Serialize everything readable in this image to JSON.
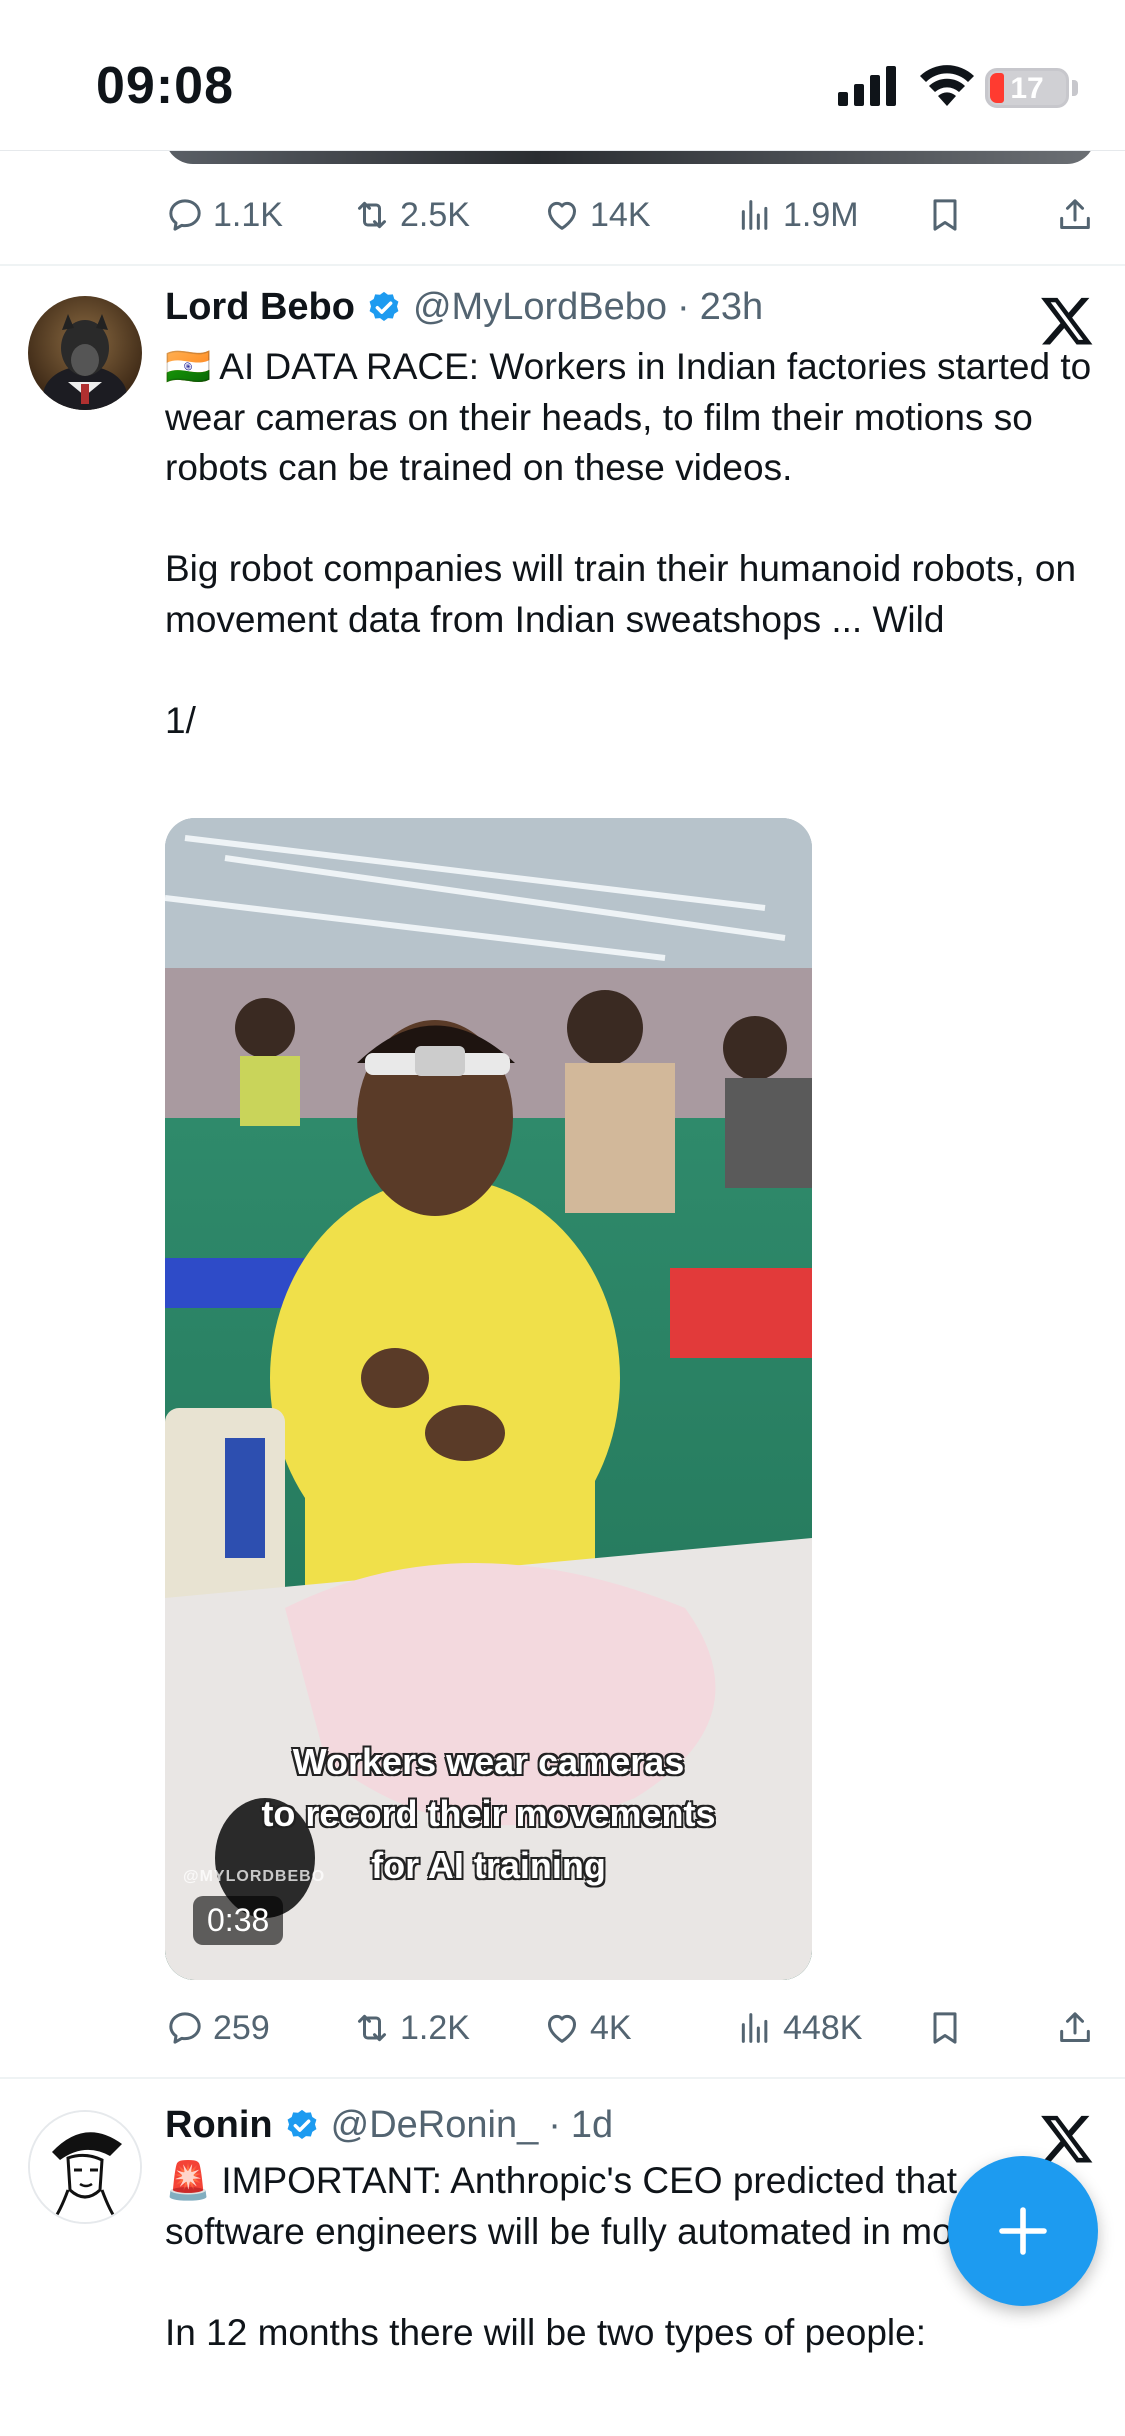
{
  "status_bar": {
    "time": "09:08",
    "battery": "17"
  },
  "prev_tweet": {
    "replies": "1.1K",
    "retweets": "2.5K",
    "likes": "14K",
    "views": "1.9M"
  },
  "tweet1": {
    "name": "Lord Bebo",
    "handle": "@MyLordBebo",
    "dot": "·",
    "time": "23h",
    "text": "🇮🇳 AI DATA RACE: Workers in Indian factories started to wear cameras on their heads, to film their motions so robots can be trained on these videos.\n\nBig robot companies will train their humanoid robots, on movement data from Indian sweatshops ... Wild\n\n1/",
    "video": {
      "caption_lines": [
        "Workers wear cameras",
        "to record their movements",
        "for AI training"
      ],
      "watermark": "@MYLORDBEBO",
      "duration": "0:38"
    },
    "replies": "259",
    "retweets": "1.2K",
    "likes": "4K",
    "views": "448K"
  },
  "tweet2": {
    "name": "Ronin",
    "handle": "@DeRonin_",
    "dot": "·",
    "time": "1d",
    "text": "🚨 IMPORTANT: Anthropic's CEO predicted that software engineers will be fully automated in months\n\nIn 12 months there will be two types of people:"
  },
  "colors": {
    "accent": "#1d9bf0",
    "muted": "#536471",
    "text": "#0f1419"
  },
  "icons": [
    "reply-icon",
    "retweet-icon",
    "like-icon",
    "views-icon",
    "bookmark-icon",
    "share-icon",
    "verified-icon",
    "x-logo-icon",
    "plus-icon"
  ]
}
